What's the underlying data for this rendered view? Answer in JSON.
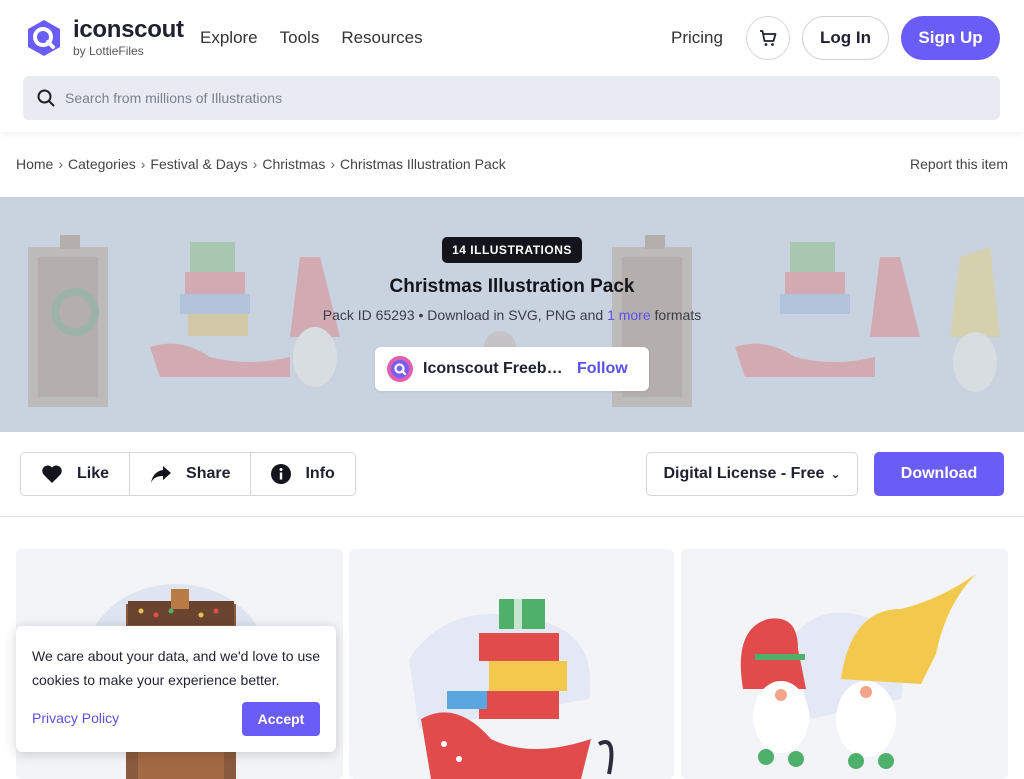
{
  "brand": {
    "name": "iconscout",
    "sub": "by LottieFiles",
    "accent": "#6a5cf6"
  },
  "nav": {
    "items": [
      "Explore",
      "Tools",
      "Resources"
    ],
    "pricing": "Pricing",
    "login": "Log In",
    "signup": "Sign Up"
  },
  "search": {
    "placeholder": "Search from millions of Illustrations"
  },
  "breadcrumb": [
    "Home",
    "Categories",
    "Festival & Days",
    "Christmas",
    "Christmas Illustration Pack"
  ],
  "report": "Report this item",
  "pack": {
    "badge": "14 ILLUSTRATIONS",
    "title": "Christmas Illustration Pack",
    "meta_prefix": "Pack ID 65293 •  Download in SVG, PNG and ",
    "meta_link": "1 more",
    "meta_suffix": " formats",
    "author": "Iconscout Freeb…",
    "follow": "Follow"
  },
  "actions": {
    "like": "Like",
    "share": "Share",
    "info": "Info"
  },
  "license": "Digital License - Free",
  "download": "Download",
  "cookie": {
    "text": "We care about your data, and we'd love to use cookies to make your experience better.",
    "policy": "Privacy Policy",
    "accept": "Accept"
  }
}
